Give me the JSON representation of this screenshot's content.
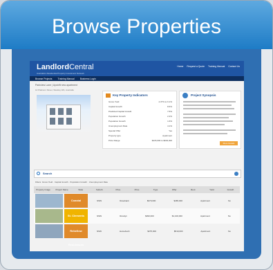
{
  "header": {
    "title": "Browse Properties"
  },
  "site": {
    "logo_bold": "Landlord",
    "logo_rest": "Central",
    "tagline": "Australia's Residential Property Investment Network",
    "topnav": [
      "Home",
      "Request a Quote",
      "Training Manual",
      "Contact Us"
    ],
    "menu": [
      "Browse Projects",
      "Training Manual",
      "Business Login"
    ]
  },
  "property": {
    "breadcrumb": "Parkview Lane | Upshift new apartment",
    "address": "14 Platinum Street, Westley WA, Australia"
  },
  "kpi": {
    "title": "Key Property Indicators",
    "rows": [
      {
        "label": "Gross Yield",
        "value": "4.37% to 6.1%"
      },
      {
        "label": "Capital Growth",
        "value": "8.6%"
      },
      {
        "label": "Predicted Capital Growth",
        "value": "7.5%"
      },
      {
        "label": "Population Growth",
        "value": "2.3%"
      },
      {
        "label": "Population Growth",
        "value": "1.6%"
      },
      {
        "label": "Unemployment Rate",
        "value": "4.1%"
      },
      {
        "label": "Special Offer",
        "value": "Yes"
      },
      {
        "label": "Property type",
        "value": "Apartment"
      },
      {
        "label": "Price Range",
        "value": "$415,000 to $604,000"
      }
    ]
  },
  "synopsis": {
    "title": "Project Synopsis",
    "button": "More Details"
  },
  "search": {
    "label": "Search"
  },
  "filters_text": "Filters: Gross Yield · Capital Growth · Population Growth · Unemployment Rate",
  "table": {
    "headers": [
      "Property Image",
      "Project Name",
      "State",
      "Suburb",
      "Price",
      "Price",
      "Type",
      "Offer",
      "Rent",
      "Yield",
      "Growth"
    ],
    "rows": [
      {
        "name": "Coastal",
        "state": "NSW",
        "suburb": "Rosebank",
        "price1": "$370,000",
        "price2": "$465,000",
        "type": "Apartment",
        "offer": "No",
        "color": "#e08a2a"
      },
      {
        "name": "St. Clements",
        "state": "NSW",
        "suburb": "Rosslyn",
        "price1": "$390,000",
        "price2": "$1,100,000",
        "type": "Apartment",
        "offer": "No",
        "color": "#f0b400"
      },
      {
        "name": "Rebellow Residences",
        "state": "NSW",
        "suburb": "Homebush",
        "price1": "$375,000",
        "price2": "$510,000",
        "type": "Apartment",
        "offer": "No",
        "color": "#e08a2a"
      }
    ]
  }
}
